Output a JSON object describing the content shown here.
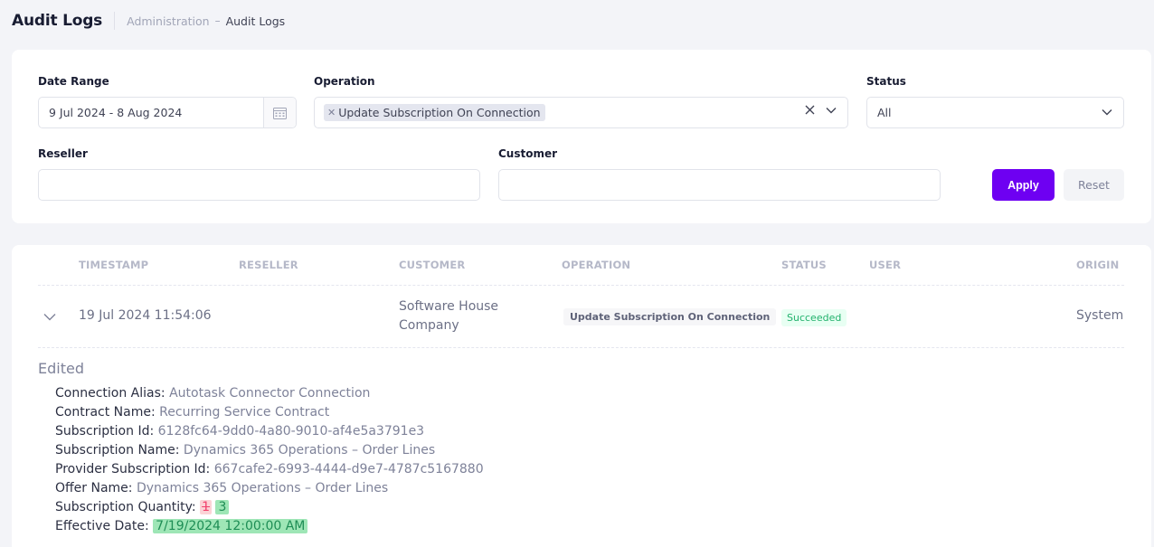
{
  "page": {
    "title": "Audit Logs",
    "breadcrumb": {
      "parent": "Administration",
      "separator": "–",
      "current": "Audit Logs"
    }
  },
  "filters": {
    "date_range": {
      "label": "Date Range",
      "value": "9 Jul 2024 - 8 Aug 2024",
      "icon": "calendar-icon"
    },
    "operation": {
      "label": "Operation",
      "selected_chip": "Update Subscription On Connection",
      "icons": [
        "clear-icon",
        "chevron-down-icon"
      ]
    },
    "status": {
      "label": "Status",
      "value": "All",
      "icon": "chevron-down-icon"
    },
    "reseller": {
      "label": "Reseller",
      "value": ""
    },
    "customer": {
      "label": "Customer",
      "value": ""
    },
    "apply_label": "Apply",
    "reset_label": "Reset"
  },
  "table": {
    "columns": [
      "TIMESTAMP",
      "RESELLER",
      "CUSTOMER",
      "OPERATION",
      "STATUS",
      "USER",
      "ORIGIN"
    ],
    "rows": [
      {
        "expanded": true,
        "timestamp": "19 Jul 2024 11:54:06",
        "reseller": "",
        "customer_line1": "Software House",
        "customer_line2": "Company",
        "operation": "Update Subscription On Connection",
        "status": "Succeeded",
        "user": "",
        "origin": "System"
      }
    ]
  },
  "details": {
    "heading": "Edited",
    "fields": [
      {
        "key": "Connection Alias:",
        "value": "Autotask Connector Connection"
      },
      {
        "key": "Contract Name:",
        "value": "Recurring Service Contract"
      },
      {
        "key": "Subscription Id:",
        "value": "6128fc64-9dd0-4a80-9010-af4e5a3791e3"
      },
      {
        "key": "Subscription Name:",
        "value": "Dynamics 365 Operations – Order Lines"
      },
      {
        "key": "Provider Subscription Id:",
        "value": "667cafe2-6993-4444-d9e7-4787c5167880"
      },
      {
        "key": "Offer Name:",
        "value": "Dynamics 365 Operations – Order Lines"
      }
    ],
    "quantity": {
      "key": "Subscription Quantity:",
      "old": "1",
      "new": "3"
    },
    "effective_date": {
      "key": "Effective Date:",
      "new": "7/19/2024 12:00:00 AM"
    }
  },
  "colors": {
    "accent": "#6e00f2",
    "success_text": "#23b26d",
    "success_bg": "#e8fff3",
    "removed_bg": "#fbd3d6",
    "added_bg": "#9ee6b6"
  }
}
